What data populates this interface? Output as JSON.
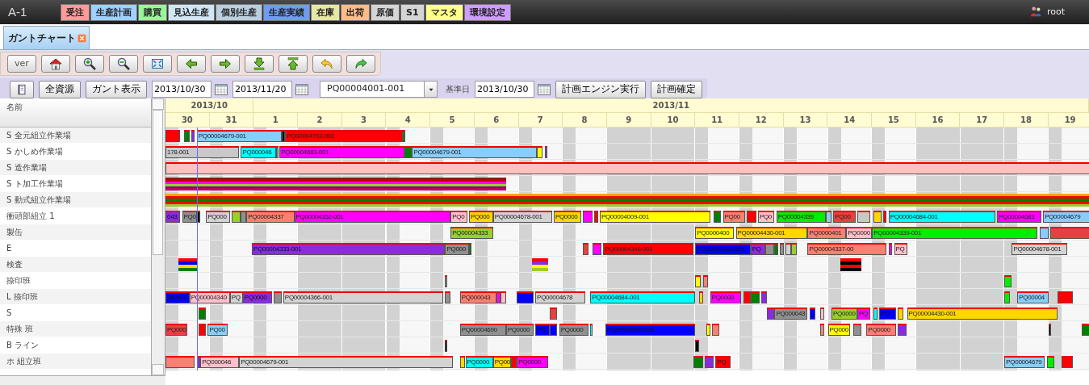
{
  "app": {
    "title": "A-1",
    "user": "root"
  },
  "menu": [
    {
      "label": "受注",
      "color": "#ff9a9a"
    },
    {
      "label": "生産計画",
      "color": "#9fd0ff"
    },
    {
      "label": "購買",
      "color": "#9af59a"
    },
    {
      "label": "見込生産",
      "color": "#cfe6f5"
    },
    {
      "label": "個別生産",
      "color": "#b9cfdf"
    },
    {
      "label": "生産実績",
      "color": "#6f9cf0"
    },
    {
      "label": "在庫",
      "color": "#e6e6a6"
    },
    {
      "label": "出荷",
      "color": "#ffbc8a"
    },
    {
      "label": "原価",
      "color": "#d4d4d4"
    },
    {
      "label": "S1",
      "color": "#d4d4d4"
    },
    {
      "label": "マスタ",
      "color": "#ffff8c"
    },
    {
      "label": "環境設定",
      "color": "#cf9cff"
    }
  ],
  "tabs": [
    {
      "label": "ガントチャート",
      "selected": true
    }
  ],
  "toolbar": [
    {
      "kind": "text",
      "label": "ver"
    },
    {
      "kind": "home"
    },
    {
      "kind": "zoom-in"
    },
    {
      "kind": "zoom-out"
    },
    {
      "kind": "fit"
    },
    {
      "kind": "back"
    },
    {
      "kind": "forward"
    },
    {
      "kind": "download"
    },
    {
      "kind": "upload"
    },
    {
      "kind": "undo"
    },
    {
      "kind": "redo"
    }
  ],
  "filter_bar": [
    {
      "kind": "icon"
    },
    {
      "kind": "button",
      "label": "全資源"
    },
    {
      "kind": "button",
      "label": "ガント表示"
    },
    {
      "kind": "date",
      "value": "2013/10/30"
    },
    {
      "kind": "date",
      "value": "2013/11/20"
    },
    {
      "kind": "select",
      "value": "PQ00004001-001"
    },
    {
      "kind": "label",
      "label": "基準日"
    },
    {
      "kind": "date",
      "value": "2013/10/30"
    },
    {
      "kind": "button",
      "label": "計画エンジン実行"
    },
    {
      "kind": "button",
      "label": "計画確定"
    }
  ],
  "gantt": {
    "name_header": "名前",
    "months": [
      {
        "label": "2013/10",
        "days": [
          {
            "label": "30",
            "holiday": false
          },
          {
            "label": "31",
            "holiday": false
          }
        ]
      },
      {
        "label": "2013/11",
        "days": [
          {
            "label": "1",
            "holiday": false
          },
          {
            "label": "2",
            "holiday": true
          },
          {
            "label": "3",
            "holiday": true
          },
          {
            "label": "4",
            "holiday": false
          },
          {
            "label": "5",
            "holiday": false
          },
          {
            "label": "6",
            "holiday": false
          },
          {
            "label": "7",
            "holiday": false
          },
          {
            "label": "8",
            "holiday": false
          },
          {
            "label": "9",
            "holiday": true
          },
          {
            "label": "10",
            "holiday": true
          },
          {
            "label": "11",
            "holiday": false
          },
          {
            "label": "12",
            "holiday": false
          },
          {
            "label": "13",
            "holiday": false
          },
          {
            "label": "14",
            "holiday": false
          },
          {
            "label": "15",
            "holiday": false
          },
          {
            "label": "16",
            "holiday": true
          },
          {
            "label": "17",
            "holiday": true
          },
          {
            "label": "18",
            "holiday": false
          },
          {
            "label": "19",
            "holiday": false
          }
        ]
      }
    ],
    "rows": [
      {
        "name": "S 全元組立作業場",
        "bars": [
          {
            "color": "#ff0000"
          },
          {
            "color": "#008000"
          },
          {
            "color": "#8a2be2"
          },
          {
            "color": "#87cefa",
            "label": "PQ00004679-001"
          },
          {
            "color": "#000000"
          },
          {
            "color": "#ff0000",
            "label": "PQ00004702-001"
          },
          {
            "color": "#008000"
          }
        ]
      },
      {
        "name": "S かしめ作業場",
        "bars": [
          {
            "color": "#c8c8c8",
            "label": "178-001"
          },
          {
            "color": "#00ffff",
            "label": "PQ000046"
          },
          {
            "color": "#909090"
          },
          {
            "color": "#ff00ff",
            "label": "PQ00004683-001"
          },
          {
            "color": "#008000"
          },
          {
            "color": "#87cefa",
            "label": "PQ00004679-001"
          },
          {
            "color": "#ffff00"
          },
          {
            "color": "#8a2be2"
          }
        ]
      },
      {
        "name": "S 造作業場",
        "bars": [
          {
            "color": "#ffc0c0"
          }
        ]
      },
      {
        "name": "S ト加工作業場",
        "bars": [
          {
            "kind": "stack",
            "stripes": [
              {
                "color": "#8b1a1a"
              },
              {
                "color": "#c00000"
              },
              {
                "color": "#ff00ff"
              },
              {
                "color": "#9acd32"
              },
              {
                "color": "#800080"
              },
              {
                "color": "#c00060"
              }
            ]
          }
        ]
      },
      {
        "name": "S 動式組立作業場",
        "bars": [
          {
            "kind": "stack",
            "stripes": [
              {
                "color": "#ffa500"
              },
              {
                "color": "#ff0000"
              },
              {
                "color": "#008000"
              },
              {
                "color": "#ff0000"
              },
              {
                "color": "#9acd32"
              }
            ]
          }
        ]
      },
      {
        "name": "衝頭部組立 1",
        "bars": [
          {
            "color": "#8a2be2",
            "label": "043"
          },
          {
            "color": "#909090",
            "label": "PQ0"
          },
          {
            "color": "#000000"
          },
          {
            "color": "#d3d3d3",
            "label": "PQ000"
          },
          {
            "color": "#9acd32"
          },
          {
            "color": "#909090"
          },
          {
            "color": "#fa8072",
            "label": "PQ00004337"
          },
          {
            "color": "#ff00ff",
            "label": "PQ00004352-001"
          },
          {
            "color": "#ffc0cb",
            "label": "PQ0"
          },
          {
            "color": "#ffd700",
            "label": "PQ000"
          },
          {
            "color": "#d3d3d3",
            "label": "PQ00004678-001"
          },
          {
            "color": "#ffd700",
            "label": "PQ0000"
          },
          {
            "color": "#ff00ff"
          },
          {
            "color": "#ff0000"
          },
          {
            "color": "#ffff00",
            "label": "PQ00004009-001"
          },
          {
            "color": "#008000"
          },
          {
            "color": "#fa8072",
            "label": "PQ00"
          },
          {
            "color": "#ff0000"
          },
          {
            "color": "#ffc0cb",
            "label": "PQ0"
          },
          {
            "color": "#00ee00",
            "label": "PQ00004339"
          },
          {
            "color": "#87cefa"
          },
          {
            "color": "#e84040",
            "label": "PQ00"
          },
          {
            "color": "#c8c8c8"
          },
          {
            "color": "#ffd700"
          },
          {
            "color": "#ff0000"
          },
          {
            "color": "#00ffff",
            "label": "PQ00004684-001"
          },
          {
            "color": "#ff00ff",
            "label": "PQ00004683"
          },
          {
            "color": "#87cefa",
            "label": "PQ00004679"
          }
        ]
      },
      {
        "name": "製缶",
        "bars": [
          {
            "color": "#9acd32",
            "label": "PQ00004333"
          },
          {
            "color": "#ffff00",
            "label": "PQ0000400"
          },
          {
            "color": "#ffd700",
            "label": "PQ00004430-001"
          },
          {
            "color": "#fa8072",
            "label": "PQ0000401"
          },
          {
            "color": "#ffc0cb",
            "label": "PQ0000"
          },
          {
            "color": "#00ee00",
            "label": "PQ00004339-001"
          },
          {
            "color": "#87cefa"
          },
          {
            "color": "#e84040"
          }
        ]
      },
      {
        "name": "E",
        "bars": [
          {
            "color": "#8a2be2",
            "label": "PQ00004333-001"
          },
          {
            "color": "#909090",
            "label": "PQ000"
          },
          {
            "color": "#008000"
          },
          {
            "color": "#e84040"
          },
          {
            "color": "#ff00ff"
          },
          {
            "color": "#ff0000",
            "label": "PQ00004346-001"
          },
          {
            "color": "#0000ff",
            "label": "PQ00004339-001"
          },
          {
            "color": "#8a2be2",
            "label": "PQ"
          },
          {
            "color": "#909090"
          },
          {
            "color": "#008000"
          },
          {
            "color": "#909090"
          },
          {
            "color": "#d3d3d3"
          },
          {
            "color": "#9acd32"
          },
          {
            "color": "#fa8072",
            "label": "PQ00004337-00"
          },
          {
            "color": "#ff00ff"
          },
          {
            "color": "#ffc0cb",
            "label": "PQ"
          },
          {
            "color": "#d3d3d3",
            "label": "PQ00004678-001"
          }
        ]
      },
      {
        "name": "検査",
        "bars": [
          {
            "kind": "stack",
            "stripes": [
              {
                "color": "#ff0000"
              },
              {
                "color": "#0000ff"
              },
              {
                "color": "#ffd700"
              },
              {
                "color": "#008000"
              }
            ]
          },
          {
            "kind": "stack",
            "stripes": [
              {
                "color": "#ff0000"
              },
              {
                "color": "#8a2be2"
              },
              {
                "color": "#ffff00"
              },
              {
                "color": "#9acd32"
              }
            ]
          },
          {
            "kind": "stack",
            "stripes": [
              {
                "color": "#ff0000"
              },
              {
                "color": "#000000"
              },
              {
                "color": "#ff0000"
              },
              {
                "color": "#000000"
              }
            ]
          }
        ]
      },
      {
        "name": "捺印班",
        "bars": [
          {
            "color": "#909090"
          },
          {
            "color": "#ffff00"
          },
          {
            "color": "#fa8072"
          },
          {
            "color": "#00ee00"
          }
        ]
      },
      {
        "name": "L 捺印班",
        "bars": [
          {
            "color": "#0000ff",
            "label": "35-001"
          },
          {
            "color": "#ffc0cb",
            "label": "PQ00004340"
          },
          {
            "color": "#d3d3d3",
            "label": "PQ"
          },
          {
            "color": "#8a2be2",
            "label": "PQ0000"
          },
          {
            "color": "#909090"
          },
          {
            "color": "#d3d3d3",
            "label": "PQ00004366-001"
          },
          {
            "color": "#909090"
          },
          {
            "color": "#fa8072",
            "label": "PQ000043"
          },
          {
            "color": "#ff00ff"
          },
          {
            "color": "#ffc0cb"
          },
          {
            "color": "#0000ff"
          },
          {
            "color": "#d3d3d3",
            "label": "PQ00004678"
          },
          {
            "color": "#00ffff",
            "label": "PQ00004684-001"
          },
          {
            "color": "#ffd700"
          },
          {
            "color": "#ff00ff",
            "label": "PQ0000"
          },
          {
            "color": "#ff0000"
          },
          {
            "color": "#008000"
          },
          {
            "color": "#8a2be2"
          },
          {
            "color": "#00ee00"
          },
          {
            "color": "#87cefa",
            "label": "PQ00004"
          },
          {
            "color": "#ff0000"
          }
        ]
      },
      {
        "name": "S",
        "bars": [
          {
            "color": "#008000"
          },
          {
            "color": "#e84040"
          },
          {
            "color": "#8a2be2"
          },
          {
            "color": "#909090",
            "label": "PQ000043"
          },
          {
            "color": "#0000ff"
          },
          {
            "color": "#ffc0cb"
          },
          {
            "color": "#9acd32",
            "label": "PQ0000"
          },
          {
            "color": "#ff00ff",
            "label": "PQ"
          },
          {
            "color": "#00ffff"
          },
          {
            "color": "#0000ff",
            "label": "PQ"
          },
          {
            "color": "#ffd700"
          },
          {
            "color": "#ffd700",
            "label": "PQ00004430-001"
          }
        ]
      },
      {
        "name": "特殊 班",
        "bars": [
          {
            "color": "#e84040",
            "label": "PQ000"
          },
          {
            "color": "#ff0000"
          },
          {
            "color": "#87cefa",
            "label": "PQ00"
          },
          {
            "color": "#909090",
            "label": "PQ00004690"
          },
          {
            "color": "#909090",
            "label": "PQ0000"
          },
          {
            "color": "#0000ff",
            "label": "PQ"
          },
          {
            "color": "#0000ff"
          },
          {
            "color": "#909090",
            "label": "PQ0000"
          },
          {
            "color": "#00ffff"
          },
          {
            "color": "#0000ff",
            "label": "PQ00004670-001"
          },
          {
            "color": "#ffff00"
          },
          {
            "color": "#fa8072"
          },
          {
            "color": "#fa8072"
          },
          {
            "color": "#ffff00",
            "label": "PQ000"
          },
          {
            "color": "#909090"
          },
          {
            "color": "#fa8072",
            "label": "PQ0000"
          },
          {
            "color": "#8a2be2"
          },
          {
            "color": "#000000"
          },
          {
            "color": "#008000"
          }
        ]
      },
      {
        "name": "B ライン",
        "bars": [
          {
            "color": "#000000"
          },
          {
            "color": "#000000"
          }
        ]
      },
      {
        "name": "ホ 組立班",
        "bars": [
          {
            "color": "#fa8072"
          },
          {
            "color": "#8a2be2"
          },
          {
            "color": "#ffc0cb",
            "label": "PQ000046"
          },
          {
            "color": "#d3d3d3",
            "label": "PQ00004679-001"
          },
          {
            "color": "#ffd700"
          },
          {
            "color": "#00ffff",
            "label": "PQ0000"
          },
          {
            "color": "#ffd700",
            "label": "PQ00"
          },
          {
            "color": "#ff0000"
          },
          {
            "color": "#ff00ff",
            "label": "PQ0000"
          },
          {
            "color": "#008000"
          },
          {
            "color": "#8a2be2"
          },
          {
            "color": "#ff0000",
            "label": "PQ"
          },
          {
            "color": "#87cefa",
            "label": "PQ00004679"
          },
          {
            "color": "#00ee00"
          },
          {
            "color": "#ff0000"
          }
        ]
      }
    ]
  }
}
